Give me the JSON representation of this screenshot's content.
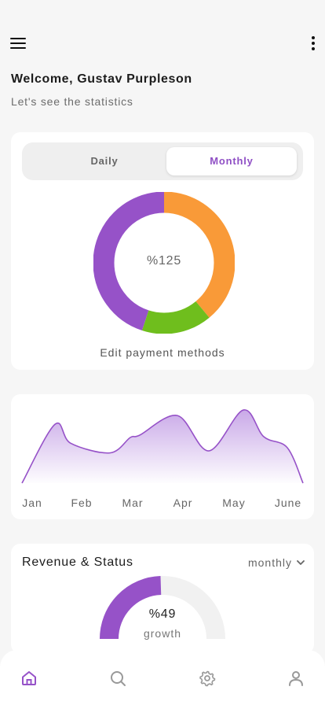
{
  "header": {
    "welcome": "Welcome, Gustav Purpleson",
    "subtitle": "Let's see the statistics",
    "menu_icon": "hamburger-menu-icon",
    "more_icon": "more-vertical-icon"
  },
  "summary_card": {
    "tabs": [
      {
        "label": "Daily",
        "active": false
      },
      {
        "label": "Monthly",
        "active": true
      }
    ],
    "donut_center_label": "%125",
    "edit_link": "Edit payment methods"
  },
  "trend_card": {
    "months": [
      "Jan",
      "Feb",
      "Mar",
      "Apr",
      "May",
      "June"
    ]
  },
  "revenue_card": {
    "title": "Revenue & Status",
    "period": "monthly",
    "gauge_value": "%49",
    "gauge_caption": "growth",
    "gauge_fraction": 0.49
  },
  "bottom_nav": {
    "items": [
      {
        "icon": "home-icon",
        "active": true
      },
      {
        "icon": "search-icon",
        "active": false
      },
      {
        "icon": "settings-icon",
        "active": false
      },
      {
        "icon": "profile-icon",
        "active": false
      }
    ]
  },
  "chart_data": [
    {
      "type": "pie",
      "title": "",
      "center_label": "%125",
      "categories": [
        "",
        "",
        ""
      ],
      "values": [
        39,
        16,
        45
      ],
      "colors": [
        "#f99a38",
        "#6fbe1d",
        "#9652c8"
      ]
    },
    {
      "type": "area",
      "title": "",
      "x": [
        "Jan",
        "Feb",
        "Mar",
        "Apr",
        "May",
        "June"
      ],
      "values": [
        60,
        72,
        38,
        85,
        92,
        5
      ],
      "grid": false,
      "legend": "none",
      "colors": [
        "#9652c8"
      ]
    }
  ],
  "colors": {
    "accent": "#9652c8",
    "orange": "#f99a38",
    "green": "#6fbe1d",
    "background": "#f6f6f6"
  }
}
